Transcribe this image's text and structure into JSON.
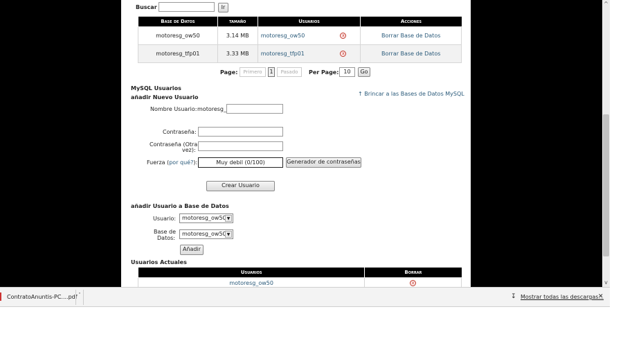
{
  "search": {
    "label": "Buscar",
    "value": "",
    "go_label": "Ir"
  },
  "db_table": {
    "headers": [
      "Base de Datos",
      "tamaño",
      "Usuarios",
      "Acciones"
    ],
    "rows": [
      {
        "db": "motoresg_ow50",
        "size": "3.14 MB",
        "user": "motoresg_ow50",
        "action": "Borrar Base de Datos"
      },
      {
        "db": "motoresg_tfp01",
        "size": "3.33 MB",
        "user": "motoresg_tfp01",
        "action": "Borrar Base de Datos"
      }
    ]
  },
  "pager": {
    "page_label": "Page:",
    "first": "Primero",
    "current": "1",
    "last": "Pasado",
    "per_page_label": "Per Page:",
    "per_page_value": "10",
    "go_label": "Go"
  },
  "mysql_users": {
    "title": "MySQL Usuarios",
    "add_title": "añadir Nuevo Usuario",
    "jump_link": "Brincar a las Bases de Datos MySQL",
    "username_label": "Nombre Usuario:",
    "username_prefix": "motoresg_",
    "password_label": "Contraseña:",
    "password2_label_1": "Contraseña (Otra",
    "password2_label_2": "vez):",
    "strength_label": "Fuerza",
    "strength_why": "por qué?",
    "strength_value": "Muy debil (0/100)",
    "generator_label": "Generador de contraseñas",
    "create_label": "Crear Usuario"
  },
  "add_user_db": {
    "title": "añadir Usuario a Base de Datos",
    "user_label": "Usuario:",
    "user_value": "motoresg_ow50",
    "db_label_1": "Base de",
    "db_label_2": "Datos:",
    "db_value": "motoresg_ow50",
    "add_label": "Añadir"
  },
  "current_users": {
    "title": "Usuarios Actuales",
    "headers": [
      "Usuarios",
      "Borrar"
    ],
    "rows": [
      {
        "user": "motoresg_ow50"
      }
    ]
  },
  "downloads_bar": {
    "file": "ContratoAnuntis-PC....pdf",
    "show_all": "Mostrar todas las descargas..."
  }
}
